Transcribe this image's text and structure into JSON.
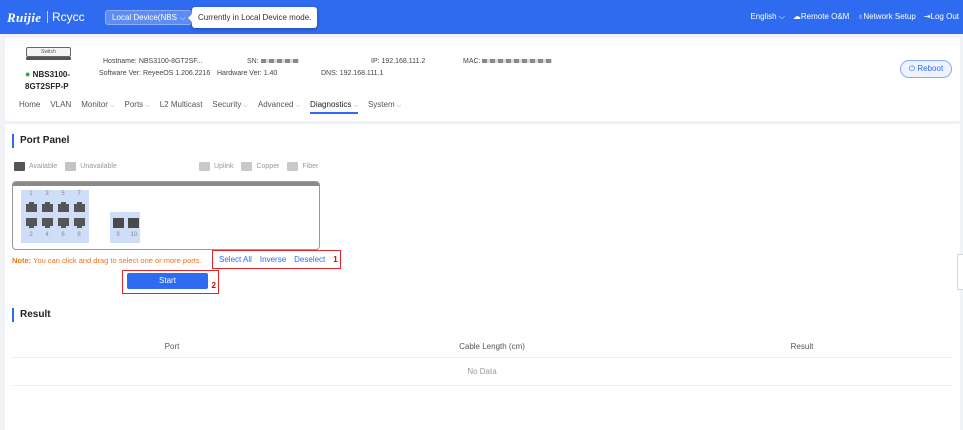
{
  "topbar": {
    "logo": "Ruijie",
    "logo_sub": "Rcycc",
    "mode_select": "Local Device(NBS",
    "tooltip": "Currently in Local Device mode.",
    "language": "English",
    "remote": "Remote O&M",
    "network_setup": "Network Setup",
    "logout": "Log Out"
  },
  "device": {
    "image_label": "Switch",
    "name_line1": "NBS3100-",
    "name_line2": "8GT2SFP-P",
    "hostname_label": "Hostname:",
    "hostname": "NBS3100-8GT2SF...",
    "software_label": "Software Ver:",
    "software": "ReyeeOS 1.206.2216",
    "sn_label": "SN:",
    "hardware_label": "Hardware Ver:",
    "hardware": "1.40",
    "ip_label": "IP:",
    "ip": "192.168.111.2",
    "dns_label": "DNS:",
    "dns": "192.168.111.1",
    "mac_label": "MAC:",
    "reboot": "Reboot",
    "status_color": "#20a940"
  },
  "nav": {
    "items": [
      "Home",
      "VLAN",
      "Monitor",
      "Ports",
      "L2 Multicast",
      "Security",
      "Advanced",
      "Diagnostics",
      "System"
    ],
    "active": "Diagnostics"
  },
  "port_panel": {
    "title": "Port Panel",
    "legend_available": "Available",
    "legend_unavailable": "Unavailable",
    "legend_uplink": "Uplink",
    "legend_copper": "Copper",
    "legend_fiber": "Fiber",
    "top_numbers": [
      "1",
      "3",
      "5",
      "7"
    ],
    "bottom_numbers": [
      "2",
      "4",
      "6",
      "8"
    ],
    "sfp_numbers": [
      "9",
      "10"
    ],
    "note_label": "Note:",
    "note_text": "You can click and drag to select one or more ports.",
    "select_all": "Select All",
    "inverse": "Inverse",
    "deselect": "Deselect",
    "marker1": "1",
    "start": "Start",
    "marker2": "2"
  },
  "result": {
    "title": "Result",
    "columns": [
      "Port",
      "Cable Length (cm)",
      "Result"
    ],
    "empty": "No Data"
  },
  "colors": {
    "accent": "#2f6bf0",
    "highlight": "#e1252b",
    "note": "#f5721b"
  }
}
